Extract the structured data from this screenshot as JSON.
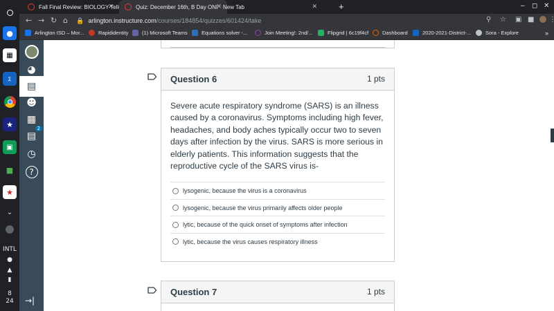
{
  "browser": {
    "tabs": [
      {
        "label": "Fall Final Review: BIOLOGY-Tello",
        "active": false
      },
      {
        "label": "Quiz: December 16th, B Day ONL",
        "active": true
      },
      {
        "label": "New Tab",
        "active": false
      }
    ],
    "url_host": "arlington.instructure.com",
    "url_path": "/courses/184854/quizzes/601424/take",
    "bookmarks": [
      {
        "label": "Arlington ISD – Mor...",
        "color": "#1a73e8"
      },
      {
        "label": "Rapididentity",
        "color": "#c0392b"
      },
      {
        "label": "(1) Microsoft Teams",
        "color": "#6264a7"
      },
      {
        "label": "Equations solver -...",
        "color": "#2c6fbb"
      },
      {
        "label": "Join Meeting!: 2nd/...",
        "color": "#8e44ad"
      },
      {
        "label": "Flipgrid | 6c19f4cf",
        "color": "#27ae60"
      },
      {
        "label": "Dashboard",
        "color": "#e66000"
      },
      {
        "label": "2020-2021-District-...",
        "color": "#1565c0"
      },
      {
        "label": "Sora - Explore",
        "color": "#bdc1c6"
      }
    ],
    "bookmarks_more": "»"
  },
  "shelf": {
    "time_hour": "8",
    "time_minute": "24",
    "lang": "INTL"
  },
  "canvas_nav": {
    "inbox_badge": "2",
    "collapse_icon": "→|"
  },
  "questions": [
    {
      "title": "Question 6",
      "points": "1 pts",
      "text": "Severe acute respiratory syndrome (SARS) is an illness caused by a coronavirus. Symptoms including high fever, headaches, and body aches typically occur two to seven days after infection by the virus. SARS is more serious in elderly patients. This information suggests that the reproductive cycle of the SARS virus is-",
      "answers": [
        "lysogenic, because the virus is a coronavirus",
        "lysogenic, because the virus primarily affects older people",
        "lytic, because of the quick onset of symptoms after infection",
        "lytic, because the virus causes respiratory illness"
      ]
    },
    {
      "title": "Question 7",
      "points": "1 pts"
    }
  ],
  "colors": {
    "canvas_nav": "#394b58",
    "text": "#2d3b45",
    "card_header": "#f5f5f5"
  }
}
